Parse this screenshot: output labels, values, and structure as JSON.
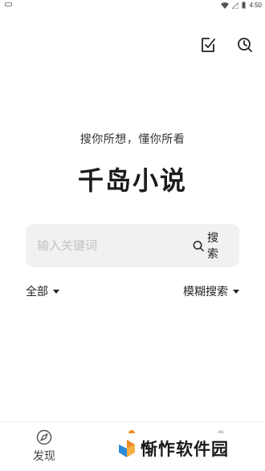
{
  "status_bar": {
    "time": "4:50"
  },
  "top_actions": {
    "checked_list_icon": "check-square-icon",
    "history_icon": "clock-search-icon"
  },
  "hero": {
    "slogan": "搜你所想，懂你所看",
    "title": "千岛小说"
  },
  "search": {
    "placeholder": "输入关键词",
    "value": "",
    "button_label": "搜索"
  },
  "filters": {
    "scope": "全部",
    "mode": "模糊搜索"
  },
  "bottom_nav": {
    "items": [
      {
        "label": "发现",
        "icon": "compass-icon"
      }
    ]
  },
  "watermark": {
    "text": "惭怍软件园"
  },
  "colors": {
    "accent": "#f28b22",
    "search_bg": "#f1f1f1"
  }
}
